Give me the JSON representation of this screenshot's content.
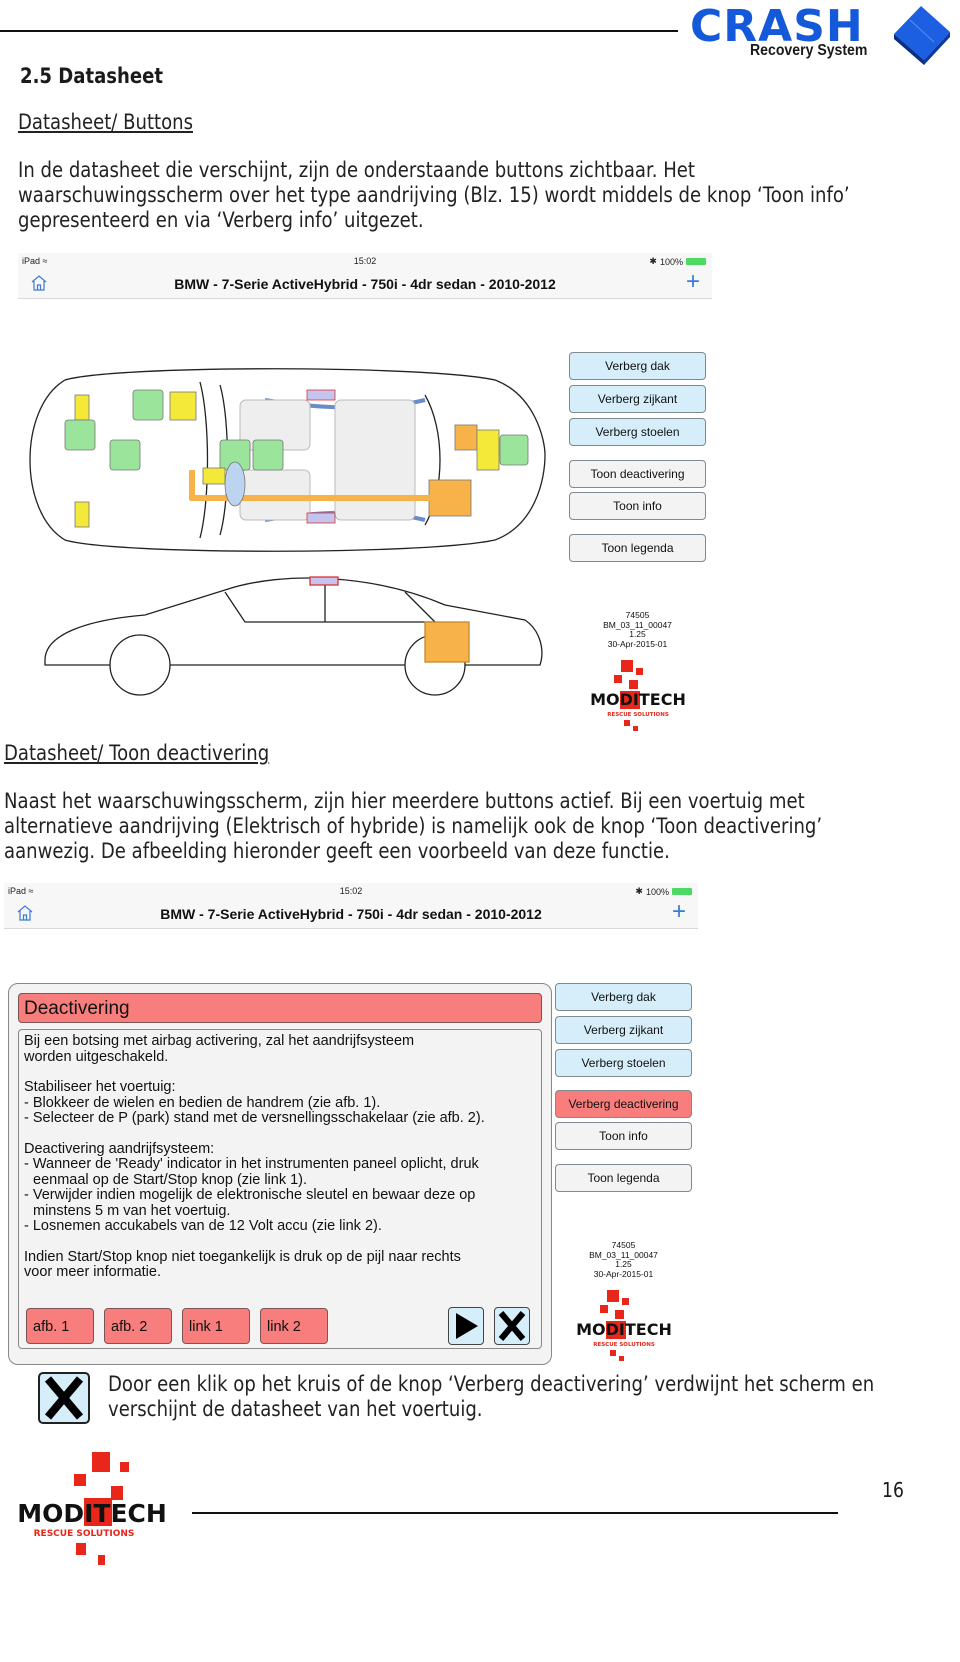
{
  "header": {
    "logo_word": "CRASH",
    "logo_sub": "Recovery System",
    "brand_color": "#1459d9"
  },
  "section_title": "2.5 Datasheet",
  "sub1": {
    "title": "Datasheet/ Buttons",
    "lines": [
      "In de datasheet die verschijnt, zijn de onderstaande buttons zichtbaar. Het",
      "waarschuwingsscherm over het type aandrijving (Blz. 15) wordt middels de knop ‘Toon info’",
      "gepresenteerd en via ‘Verberg info’ uitgezet."
    ]
  },
  "screen1": {
    "status": {
      "device": "iPad",
      "time": "15:02",
      "battery": "100%"
    },
    "nav_title": "BMW - 7-Serie ActiveHybrid - 750i - 4dr sedan - 2010-2012",
    "buttons": [
      {
        "label": "Verberg dak",
        "style": "blue"
      },
      {
        "label": "Verberg zijkant",
        "style": "blue"
      },
      {
        "label": "Verberg stoelen",
        "style": "blue"
      },
      {
        "label": "Toon deactivering",
        "style": "grey"
      },
      {
        "label": "Toon info",
        "style": "grey"
      },
      {
        "label": "Toon legenda",
        "style": "grey"
      }
    ],
    "meta": [
      "74505",
      "BM_03_11_00047",
      "1.25",
      "30-Apr-2015-01"
    ],
    "logo": {
      "word": "MODITECH",
      "tagline": "RESCUE SOLUTIONS"
    }
  },
  "sub2": {
    "title": "Datasheet/ Toon deactivering",
    "lines": [
      "Naast het waarschuwingsscherm, zijn hier meerdere buttons actief. Bij een voertuig met",
      "alternatieve aandrijving (Elektrisch of hybride) is namelijk ook de knop ‘Toon deactivering’",
      "aanwezig. De afbeelding hieronder geeft een voorbeeld van deze functie."
    ]
  },
  "screen2": {
    "status": {
      "device": "iPad",
      "time": "15:02",
      "battery": "100%"
    },
    "nav_title": "BMW - 7-Serie ActiveHybrid - 750i - 4dr sedan - 2010-2012",
    "panel": {
      "title": "Deactivering",
      "blocks": [
        [
          "Bij een botsing met airbag activering, zal het aandrijfsysteem",
          "worden uitgeschakeld."
        ],
        [
          "Stabiliseer het voertuig:",
          "- Blokkeer de wielen en bedien de handrem (zie afb. 1).",
          "- Selecteer de P (park) stand met de versnellingsschakelaar (zie afb. 2)."
        ],
        [
          "Deactivering aandrijfsysteem:",
          "- Wanneer de 'Ready' indicator in het instrumenten paneel oplicht, druk",
          "  eenmaal op de Start/Stop knop (zie link 1).",
          "- Verwijder indien mogelijk de elektronische sleutel en bewaar deze op",
          "  minstens 5 m van het voertuig.",
          "- Losnemen accukabels van de 12 Volt accu (zie link 2)."
        ],
        [
          "Indien Start/Stop knop niet toegankelijk is druk op de pijl naar rechts",
          "voor meer informatie."
        ]
      ],
      "links": [
        "afb. 1",
        "afb. 2",
        "link 1",
        "link 2"
      ]
    },
    "buttons": [
      {
        "label": "Verberg dak",
        "style": "blue"
      },
      {
        "label": "Verberg zijkant",
        "style": "blue"
      },
      {
        "label": "Verberg stoelen",
        "style": "blue"
      },
      {
        "label": "Verberg deactivering",
        "style": "red"
      },
      {
        "label": "Toon info",
        "style": "grey"
      },
      {
        "label": "Toon legenda",
        "style": "grey"
      }
    ],
    "meta": [
      "74505",
      "BM_03_11_00047",
      "1.25",
      "30-Apr-2015-01"
    ],
    "logo": {
      "word": "MODITECH",
      "tagline": "RESCUE SOLUTIONS"
    }
  },
  "close_note": {
    "lines": [
      "Door een klik op het kruis of de knop ‘Verberg deactivering’ verdwijnt het scherm en",
      "verschijnt de datasheet van het voertuig."
    ]
  },
  "footer": {
    "logo_word": "MODITECH",
    "logo_tagline": "RESCUE SOLUTIONS",
    "page": "16"
  },
  "colors": {
    "accent_red": "#f77e7c",
    "button_blue": "#d5eefa",
    "button_grey": "#f3f3f3",
    "moditech_red": "#e8261a"
  }
}
